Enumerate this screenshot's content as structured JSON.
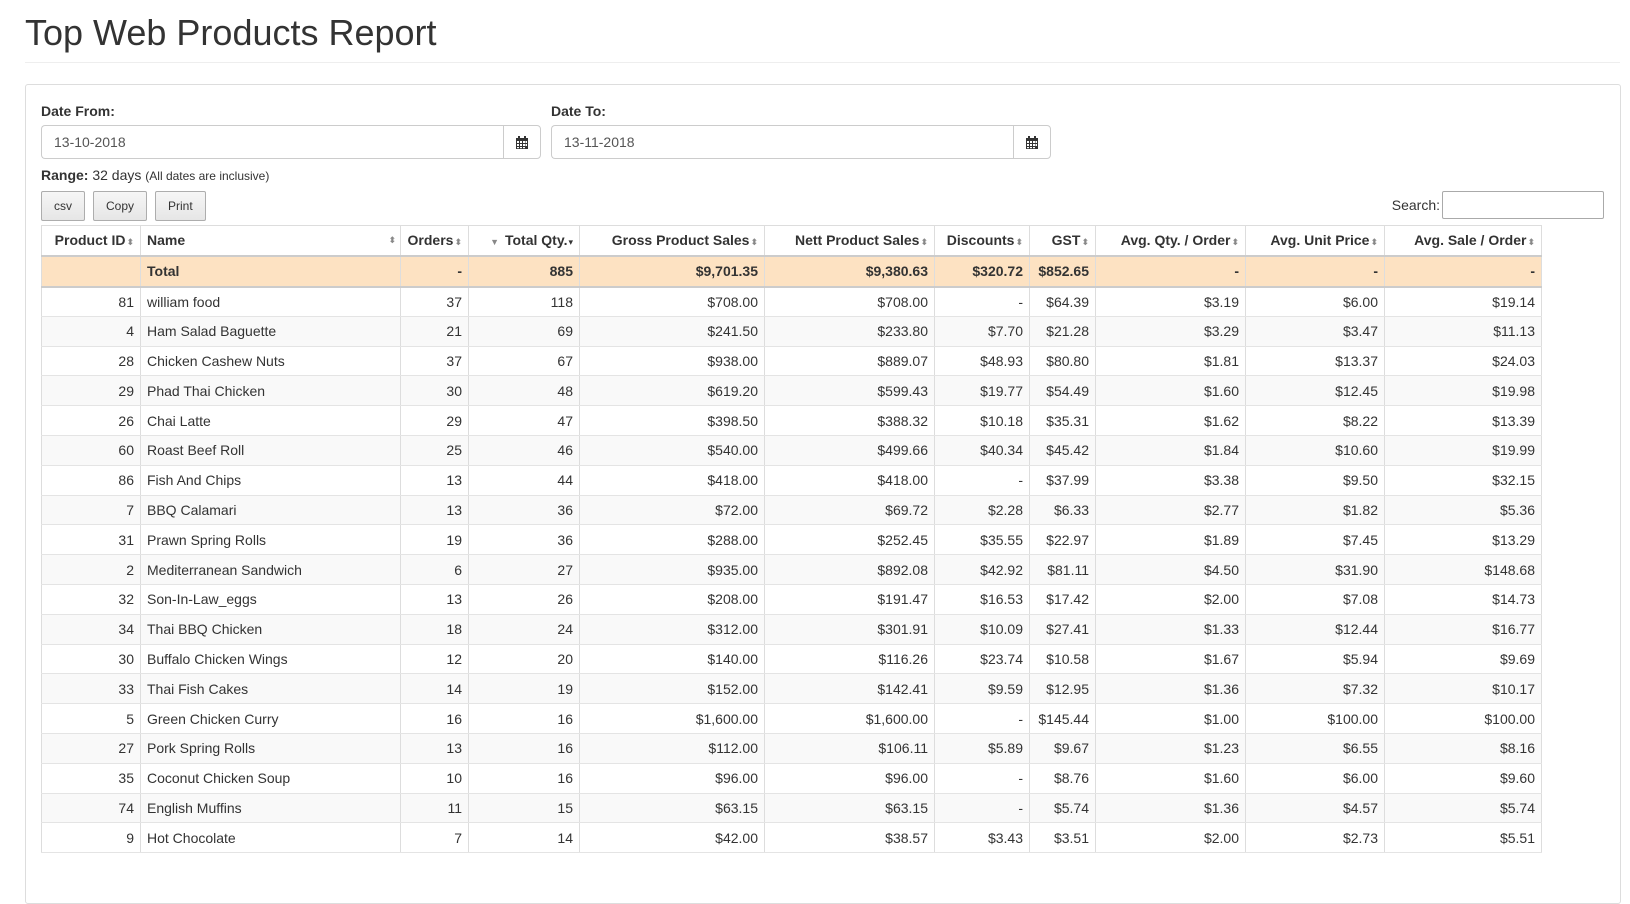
{
  "title": "Top Web Products Report",
  "date_from": {
    "label": "Date From:",
    "value": "13-10-2018"
  },
  "date_to": {
    "label": "Date To:",
    "value": "13-11-2018"
  },
  "range": {
    "label": "Range:",
    "value": "32 days",
    "note": "(All dates are inclusive)"
  },
  "buttons": {
    "csv": "csv",
    "copy": "Copy",
    "print": "Print"
  },
  "search": {
    "label": "Search:",
    "value": ""
  },
  "table": {
    "headers": [
      "Product ID",
      "Name",
      "Orders",
      "Total Qty.",
      "Gross Product Sales",
      "Nett Product Sales",
      "Discounts",
      "GST",
      "Avg. Qty. / Order",
      "Avg. Unit Price",
      "Avg. Sale / Order"
    ],
    "total": [
      "",
      "Total",
      "-",
      "885",
      "$9,701.35",
      "$9,380.63",
      "$320.72",
      "$852.65",
      "-",
      "-",
      "-"
    ],
    "rows": [
      [
        "81",
        "william food",
        "37",
        "118",
        "$708.00",
        "$708.00",
        "-",
        "$64.39",
        "$3.19",
        "$6.00",
        "$19.14"
      ],
      [
        "4",
        "Ham Salad Baguette",
        "21",
        "69",
        "$241.50",
        "$233.80",
        "$7.70",
        "$21.28",
        "$3.29",
        "$3.47",
        "$11.13"
      ],
      [
        "28",
        "Chicken Cashew Nuts",
        "37",
        "67",
        "$938.00",
        "$889.07",
        "$48.93",
        "$80.80",
        "$1.81",
        "$13.37",
        "$24.03"
      ],
      [
        "29",
        "Phad Thai Chicken",
        "30",
        "48",
        "$619.20",
        "$599.43",
        "$19.77",
        "$54.49",
        "$1.60",
        "$12.45",
        "$19.98"
      ],
      [
        "26",
        "Chai Latte",
        "29",
        "47",
        "$398.50",
        "$388.32",
        "$10.18",
        "$35.31",
        "$1.62",
        "$8.22",
        "$13.39"
      ],
      [
        "60",
        "Roast Beef Roll",
        "25",
        "46",
        "$540.00",
        "$499.66",
        "$40.34",
        "$45.42",
        "$1.84",
        "$10.60",
        "$19.99"
      ],
      [
        "86",
        "Fish And Chips",
        "13",
        "44",
        "$418.00",
        "$418.00",
        "-",
        "$37.99",
        "$3.38",
        "$9.50",
        "$32.15"
      ],
      [
        "7",
        "BBQ Calamari",
        "13",
        "36",
        "$72.00",
        "$69.72",
        "$2.28",
        "$6.33",
        "$2.77",
        "$1.82",
        "$5.36"
      ],
      [
        "31",
        "Prawn Spring Rolls",
        "19",
        "36",
        "$288.00",
        "$252.45",
        "$35.55",
        "$22.97",
        "$1.89",
        "$7.45",
        "$13.29"
      ],
      [
        "2",
        "Mediterranean Sandwich",
        "6",
        "27",
        "$935.00",
        "$892.08",
        "$42.92",
        "$81.11",
        "$4.50",
        "$31.90",
        "$148.68"
      ],
      [
        "32",
        "Son-In-Law_eggs",
        "13",
        "26",
        "$208.00",
        "$191.47",
        "$16.53",
        "$17.42",
        "$2.00",
        "$7.08",
        "$14.73"
      ],
      [
        "34",
        "Thai BBQ Chicken",
        "18",
        "24",
        "$312.00",
        "$301.91",
        "$10.09",
        "$27.41",
        "$1.33",
        "$12.44",
        "$16.77"
      ],
      [
        "30",
        "Buffalo Chicken Wings",
        "12",
        "20",
        "$140.00",
        "$116.26",
        "$23.74",
        "$10.58",
        "$1.67",
        "$5.94",
        "$9.69"
      ],
      [
        "33",
        "Thai Fish Cakes",
        "14",
        "19",
        "$152.00",
        "$142.41",
        "$9.59",
        "$12.95",
        "$1.36",
        "$7.32",
        "$10.17"
      ],
      [
        "5",
        "Green Chicken Curry",
        "16",
        "16",
        "$1,600.00",
        "$1,600.00",
        "-",
        "$145.44",
        "$1.00",
        "$100.00",
        "$100.00"
      ],
      [
        "27",
        "Pork Spring Rolls",
        "13",
        "16",
        "$112.00",
        "$106.11",
        "$5.89",
        "$9.67",
        "$1.23",
        "$6.55",
        "$8.16"
      ],
      [
        "35",
        "Coconut Chicken Soup",
        "10",
        "16",
        "$96.00",
        "$96.00",
        "-",
        "$8.76",
        "$1.60",
        "$6.00",
        "$9.60"
      ],
      [
        "74",
        "English Muffins",
        "11",
        "15",
        "$63.15",
        "$63.15",
        "-",
        "$5.74",
        "$1.36",
        "$4.57",
        "$5.74"
      ],
      [
        "9",
        "Hot Chocolate",
        "7",
        "14",
        "$42.00",
        "$38.57",
        "$3.43",
        "$3.51",
        "$2.00",
        "$2.73",
        "$5.51"
      ]
    ]
  }
}
